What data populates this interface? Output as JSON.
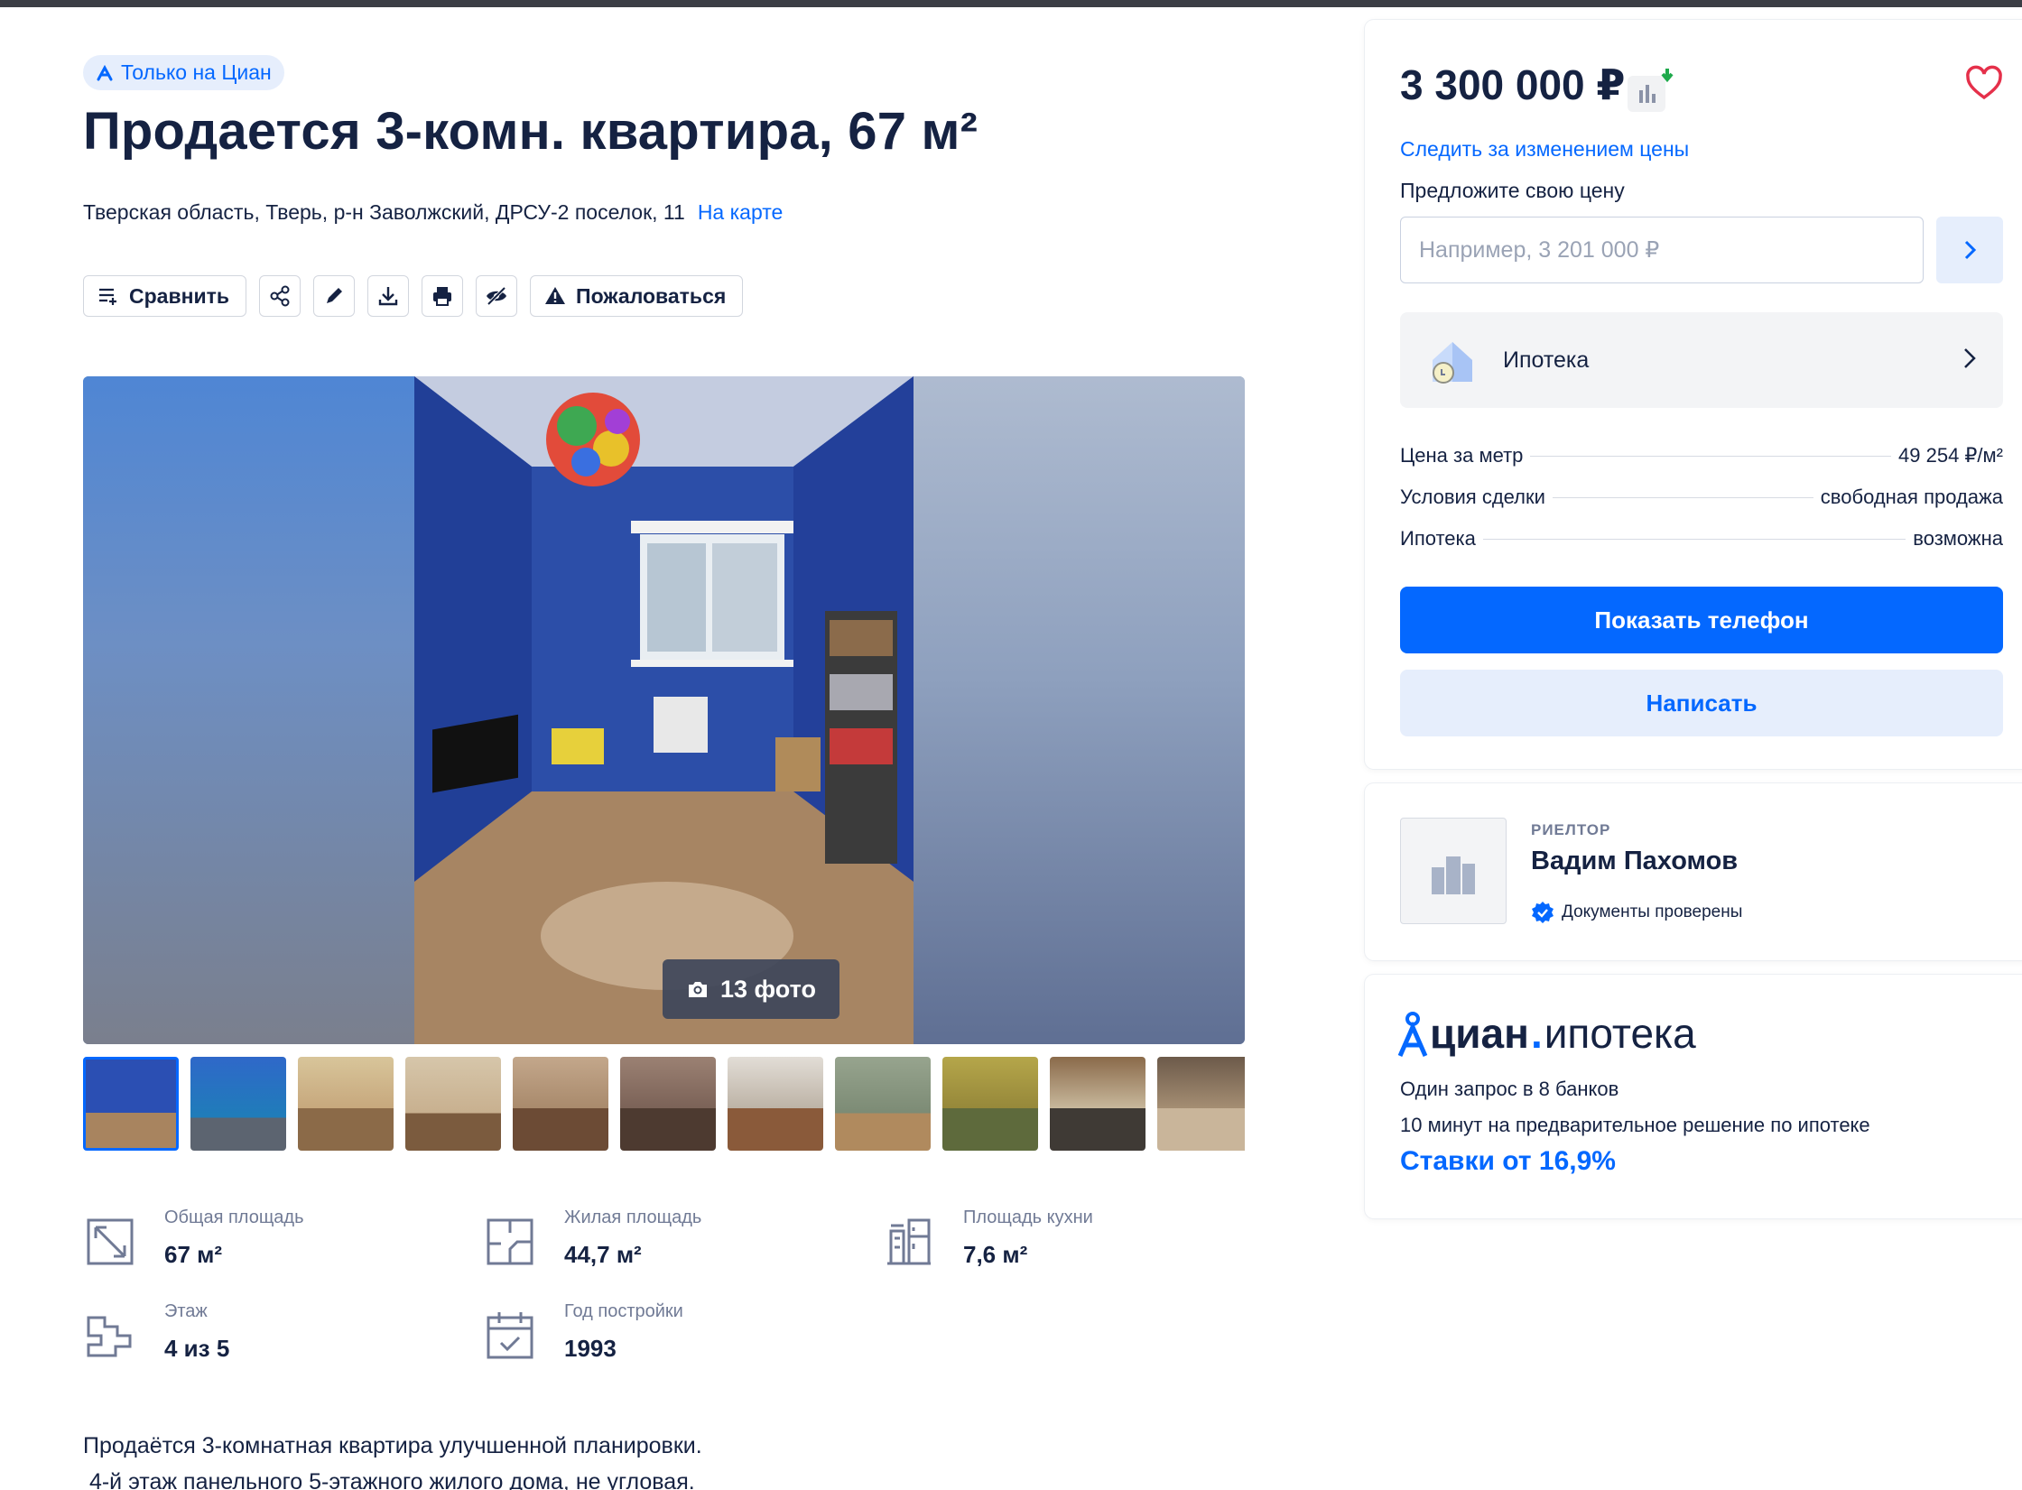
{
  "listing": {
    "badge": "Только на Циан",
    "title": "Продается 3-комн. квартира, 67 м²",
    "address": "Тверская область, Тверь, р-н Заволжский, ДРСУ-2 поселок, 11",
    "map_link": "На карте"
  },
  "toolbar": {
    "compare_label": "Сравнить",
    "report_label": "Пожаловаться",
    "icons": [
      "share-icon",
      "edit-icon",
      "download-icon",
      "print-icon",
      "hide-icon"
    ]
  },
  "gallery": {
    "photo_count_label": "13 фото",
    "thumbnails_visible": 11
  },
  "specs": [
    {
      "label": "Общая площадь",
      "value": "67 м²",
      "icon": "total-area-icon"
    },
    {
      "label": "Жилая площадь",
      "value": "44,7 м²",
      "icon": "living-area-icon"
    },
    {
      "label": "Площадь кухни",
      "value": "7,6 м²",
      "icon": "kitchen-icon"
    },
    {
      "label": "Этаж",
      "value": "4 из 5",
      "icon": "floor-icon"
    },
    {
      "label": "Год постройки",
      "value": "1993",
      "icon": "calendar-icon"
    }
  ],
  "description": {
    "line1": "Продаётся 3-комнатная квартира улучшенной планировки.",
    "line2": " 4-й этаж панельного 5-этажного жилого дома, не угловая."
  },
  "price": {
    "value": "3 300 000 ₽",
    "track_link": "Следить за изменением цены",
    "offer_label": "Предложите свою цену",
    "offer_placeholder": "Например, 3 201 000 ₽",
    "mortgage_label": "Ипотека",
    "facts": [
      {
        "label": "Цена за метр",
        "value": "49 254 ₽/м²"
      },
      {
        "label": "Условия сделки",
        "value": "свободная продажа"
      },
      {
        "label": "Ипотека",
        "value": "возможна"
      }
    ],
    "phone_button": "Показать телефон",
    "write_button": "Написать"
  },
  "agent": {
    "role": "РИЕЛТОР",
    "name": "Вадим Пахомов",
    "docs": "Документы проверены"
  },
  "ad": {
    "logo_bold": "циан",
    "logo_dot": ".",
    "logo_rest": "ипотека",
    "line1": "Один запрос в 8 банков",
    "line2": "10 минут на предварительное решение по ипотеке",
    "rate": "Ставки от 16,9%"
  },
  "colors": {
    "accent": "#0468ff",
    "text": "#152242",
    "muted": "#707a95",
    "light_blue": "#e6eefc"
  }
}
